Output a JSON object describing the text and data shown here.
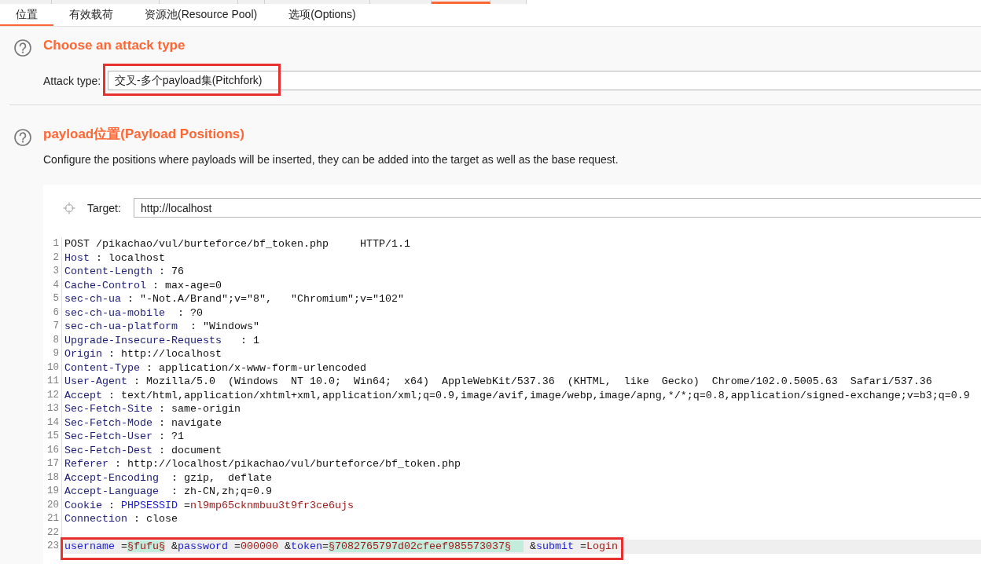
{
  "outer_tabs": [
    {
      "selected": false
    },
    {
      "selected": false
    },
    {
      "selected": false
    },
    {
      "selected": false
    },
    {
      "selected": false
    },
    {
      "selected": false
    },
    {
      "selected": true
    },
    {
      "selected": false
    }
  ],
  "tabs": [
    {
      "label": "位置",
      "selected": true
    },
    {
      "label": "有效载荷",
      "selected": false
    },
    {
      "label": "资源池(Resource Pool)",
      "selected": false
    },
    {
      "label": "选项(Options)",
      "selected": false
    }
  ],
  "attack_type_section": {
    "title": "Choose an attack type",
    "field_label": "Attack type:",
    "value": "交叉-多个payload集(Pitchfork)",
    "annotated": true
  },
  "positions_section": {
    "title": "payload位置(Payload Positions)",
    "description": "Configure the positions where payloads will be inserted, they can be added into the target as well as the base request.",
    "target_label": "Target:",
    "target_value": "http://localhost"
  },
  "editor": {
    "lines": [
      {
        "number": "1",
        "current": false,
        "annotated": false,
        "tokens": [
          {
            "kind": "plain",
            "text": "POST /pikachao/vul/burteforce/bf_token.php     HTTP/1.1"
          }
        ]
      },
      {
        "number": "2",
        "current": false,
        "annotated": false,
        "tokens": [
          {
            "kind": "header",
            "text": "Host"
          },
          {
            "kind": "plain",
            "text": " : localhost"
          }
        ]
      },
      {
        "number": "3",
        "current": false,
        "annotated": false,
        "tokens": [
          {
            "kind": "header",
            "text": "Content-Length"
          },
          {
            "kind": "plain",
            "text": " : 76"
          }
        ]
      },
      {
        "number": "4",
        "current": false,
        "annotated": false,
        "tokens": [
          {
            "kind": "header",
            "text": "Cache-Control"
          },
          {
            "kind": "plain",
            "text": " : max-age=0"
          }
        ]
      },
      {
        "number": "5",
        "current": false,
        "annotated": false,
        "tokens": [
          {
            "kind": "header",
            "text": "sec-ch-ua"
          },
          {
            "kind": "plain",
            "text": " : \"-Not.A/Brand\";v=\"8\",   \"Chromium\";v=\"102\""
          }
        ]
      },
      {
        "number": "6",
        "current": false,
        "annotated": false,
        "tokens": [
          {
            "kind": "header",
            "text": "sec-ch-ua-mobile"
          },
          {
            "kind": "plain",
            "text": "  : ?0"
          }
        ]
      },
      {
        "number": "7",
        "current": false,
        "annotated": false,
        "tokens": [
          {
            "kind": "header",
            "text": "sec-ch-ua-platform"
          },
          {
            "kind": "plain",
            "text": "  : \"Windows\""
          }
        ]
      },
      {
        "number": "8",
        "current": false,
        "annotated": false,
        "tokens": [
          {
            "kind": "header",
            "text": "Upgrade-Insecure-Requests"
          },
          {
            "kind": "plain",
            "text": "   : 1"
          }
        ]
      },
      {
        "number": "9",
        "current": false,
        "annotated": false,
        "tokens": [
          {
            "kind": "header",
            "text": "Origin"
          },
          {
            "kind": "plain",
            "text": " : http://localhost"
          }
        ]
      },
      {
        "number": "10",
        "current": false,
        "annotated": false,
        "tokens": [
          {
            "kind": "header",
            "text": "Content-Type"
          },
          {
            "kind": "plain",
            "text": " : application/x-www-form-urlencoded"
          }
        ]
      },
      {
        "number": "11",
        "current": false,
        "annotated": false,
        "tokens": [
          {
            "kind": "header",
            "text": "User-Agent"
          },
          {
            "kind": "plain",
            "text": " : Mozilla/5.0  (Windows  NT 10.0;  Win64;  x64)  AppleWebKit/537.36  (KHTML,  like  Gecko)  Chrome/102.0.5005.63  Safari/537.36"
          }
        ]
      },
      {
        "number": "12",
        "current": false,
        "annotated": false,
        "tokens": [
          {
            "kind": "header",
            "text": "Accept"
          },
          {
            "kind": "plain",
            "text": " : text/html,application/xhtml+xml,application/xml;q=0.9,image/avif,image/webp,image/apng,*/*;q=0.8,application/signed-exchange;v=b3;q=0.9"
          }
        ]
      },
      {
        "number": "13",
        "current": false,
        "annotated": false,
        "tokens": [
          {
            "kind": "header",
            "text": "Sec-Fetch-Site"
          },
          {
            "kind": "plain",
            "text": " : same-origin"
          }
        ]
      },
      {
        "number": "14",
        "current": false,
        "annotated": false,
        "tokens": [
          {
            "kind": "header",
            "text": "Sec-Fetch-Mode"
          },
          {
            "kind": "plain",
            "text": " : navigate"
          }
        ]
      },
      {
        "number": "15",
        "current": false,
        "annotated": false,
        "tokens": [
          {
            "kind": "header",
            "text": "Sec-Fetch-User"
          },
          {
            "kind": "plain",
            "text": " : ?1"
          }
        ]
      },
      {
        "number": "16",
        "current": false,
        "annotated": false,
        "tokens": [
          {
            "kind": "header",
            "text": "Sec-Fetch-Dest"
          },
          {
            "kind": "plain",
            "text": " : document"
          }
        ]
      },
      {
        "number": "17",
        "current": false,
        "annotated": false,
        "tokens": [
          {
            "kind": "header",
            "text": "Referer"
          },
          {
            "kind": "plain",
            "text": " : http://localhost/pikachao/vul/burteforce/bf_token.php"
          }
        ]
      },
      {
        "number": "18",
        "current": false,
        "annotated": false,
        "tokens": [
          {
            "kind": "header",
            "text": "Accept-Encoding"
          },
          {
            "kind": "plain",
            "text": "  : gzip,  deflate"
          }
        ]
      },
      {
        "number": "19",
        "current": false,
        "annotated": false,
        "tokens": [
          {
            "kind": "header",
            "text": "Accept-Language"
          },
          {
            "kind": "plain",
            "text": "  : zh-CN,zh;q=0.9"
          }
        ]
      },
      {
        "number": "20",
        "current": false,
        "annotated": false,
        "tokens": [
          {
            "kind": "header",
            "text": "Cookie"
          },
          {
            "kind": "plain",
            "text": " : "
          },
          {
            "kind": "param",
            "text": "PHPSESSID"
          },
          {
            "kind": "plain",
            "text": " ="
          },
          {
            "kind": "value",
            "text": "nl9mp65cknmbuu3t9fr3ce6ujs"
          }
        ]
      },
      {
        "number": "21",
        "current": false,
        "annotated": false,
        "tokens": [
          {
            "kind": "header",
            "text": "Connection"
          },
          {
            "kind": "plain",
            "text": " : close"
          }
        ]
      },
      {
        "number": "22",
        "current": false,
        "annotated": false
      },
      {
        "number": "23",
        "current": true,
        "annotated": true,
        "tokens": [
          {
            "kind": "param",
            "text": "username"
          },
          {
            "kind": "plain",
            "text": " ="
          },
          {
            "kind": "payload",
            "text": "§fufu§"
          },
          {
            "kind": "plain",
            "text": " &"
          },
          {
            "kind": "param",
            "text": "password"
          },
          {
            "kind": "plain",
            "text": " ="
          },
          {
            "kind": "value",
            "text": "000000"
          },
          {
            "kind": "plain",
            "text": " &"
          },
          {
            "kind": "param",
            "text": "token"
          },
          {
            "kind": "plain",
            "text": "="
          },
          {
            "kind": "payload",
            "text": "§7082765797d02cfeef985573037§  "
          },
          {
            "kind": "plain",
            "text": " &"
          },
          {
            "kind": "param",
            "text": "submit"
          },
          {
            "kind": "plain",
            "text": " ="
          },
          {
            "kind": "value",
            "text": "Login"
          }
        ]
      }
    ]
  }
}
